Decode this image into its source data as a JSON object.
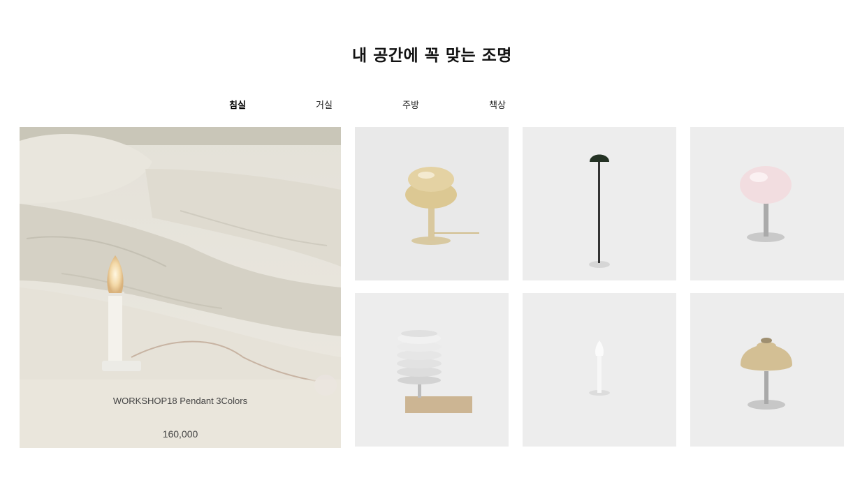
{
  "section": {
    "title": "내 공간에 꼭 맞는 조명"
  },
  "tabs": [
    {
      "label": "침실",
      "active": true
    },
    {
      "label": "거실",
      "active": false
    },
    {
      "label": "주방",
      "active": false
    },
    {
      "label": "책상",
      "active": false
    }
  ],
  "featured": {
    "name": "WORKSHOP18 Pendant 3Colors",
    "price": "160,000",
    "image": "bedroom-candle-lamp-photo"
  },
  "products": [
    {
      "image": "beige-mushroom-table-lamp"
    },
    {
      "image": "green-dome-floor-lamp"
    },
    {
      "image": "pink-globe-table-lamp"
    },
    {
      "image": "layered-silver-lamp-on-wood-base"
    },
    {
      "image": "white-candle-table-lamp"
    },
    {
      "image": "beige-dome-table-lamp"
    }
  ]
}
